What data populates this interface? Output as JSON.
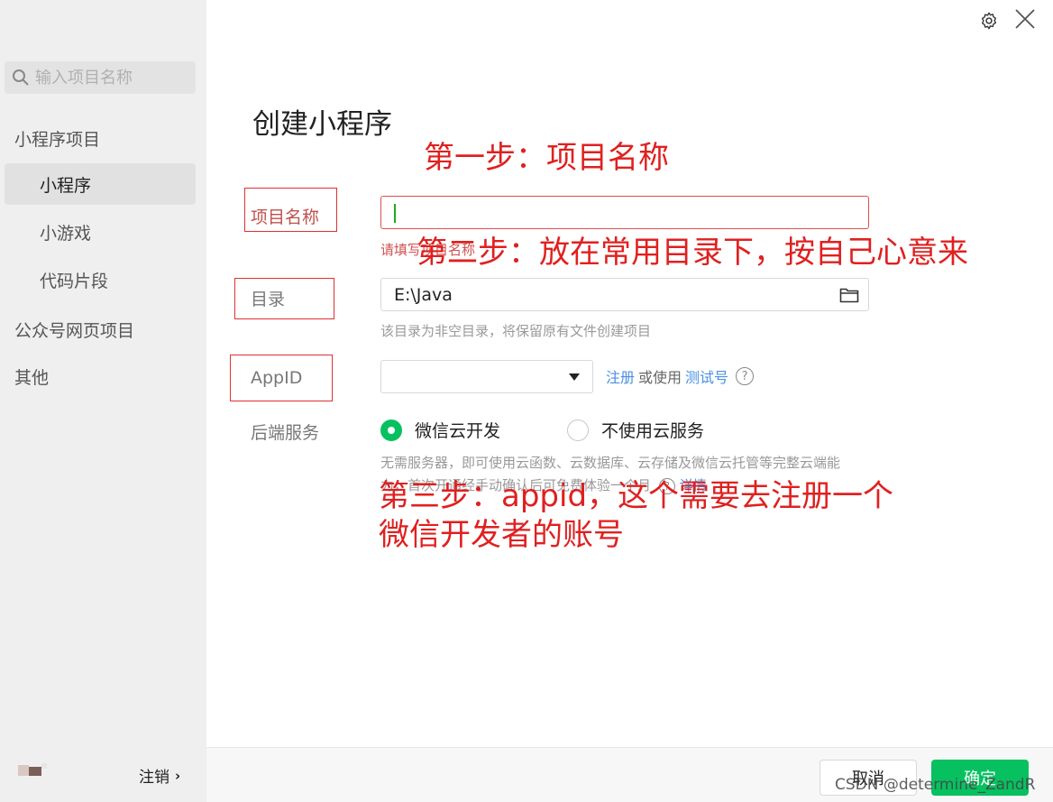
{
  "sidebar": {
    "search_placeholder": "输入项目名称",
    "groups": [
      {
        "label": "小程序项目"
      },
      {
        "label": "公众号网页项目"
      },
      {
        "label": "其他"
      }
    ],
    "items": [
      {
        "label": "小程序",
        "active": true
      },
      {
        "label": "小游戏",
        "active": false
      },
      {
        "label": "代码片段",
        "active": false
      }
    ],
    "logout_label": "注销"
  },
  "page": {
    "title": "创建小程序"
  },
  "form": {
    "name_label": "项目名称",
    "name_value": "",
    "name_error": "请填写项目名称",
    "dir_label": "目录",
    "dir_value": "E:\\Java",
    "dir_hint": "该目录为非空目录，将保留原有文件创建项目",
    "appid_label": "AppID",
    "appid_value": "",
    "appid_register": "注册",
    "appid_or": "或使用",
    "appid_test": "测试号",
    "backend_label": "后端服务",
    "backend_options": [
      {
        "label": "微信云开发",
        "selected": true
      },
      {
        "label": "不使用云服务",
        "selected": false
      }
    ],
    "backend_hint_1": "无需服务器，即可使用云函数、云数据库、云存储及微信云托管等完整云端能",
    "backend_hint_2": "力，首次开通经手动确认后可免费体验一个月",
    "details_link": "详情"
  },
  "annotations": {
    "step1": "第一步：项目名称",
    "step2": "第二步：放在常用目录下，按自己心意来",
    "step3_line1": "第三步：appid，这个需要去注册一个",
    "step3_line2": "微信开发者的账号"
  },
  "footer": {
    "cancel_label": "取消",
    "ok_label": "确定"
  },
  "watermark": "CSDN @determine_ZandR",
  "colors": {
    "accent": "#07c160",
    "link": "#4a90e2",
    "annotation": "#e02020",
    "sidebar_bg": "#efefef"
  }
}
